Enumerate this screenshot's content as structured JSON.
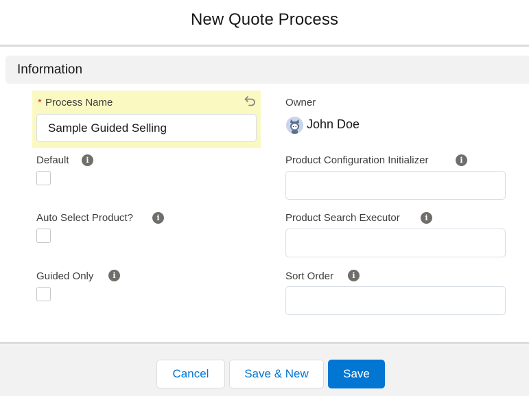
{
  "modal": {
    "title": "New Quote Process"
  },
  "section": {
    "title": "Information"
  },
  "fields": {
    "process_name": {
      "label": "Process Name",
      "required_marker": "*",
      "value": "Sample Guided Selling",
      "undo_icon": "undo-icon"
    },
    "owner": {
      "label": "Owner",
      "value": "John Doe",
      "avatar_icon": "user-avatar-icon"
    },
    "default": {
      "label": "Default",
      "info_icon": "i",
      "checked": false
    },
    "product_configuration_initializer": {
      "label": "Product Configuration Initializer",
      "info_icon": "i",
      "value": ""
    },
    "auto_select_product": {
      "label": "Auto Select Product?",
      "info_icon": "i",
      "checked": false
    },
    "product_search_executor": {
      "label": "Product Search Executor",
      "info_icon": "i",
      "value": ""
    },
    "guided_only": {
      "label": "Guided Only",
      "info_icon": "i",
      "checked": false
    },
    "sort_order": {
      "label": "Sort Order",
      "info_icon": "i",
      "value": ""
    }
  },
  "footer": {
    "cancel_label": "Cancel",
    "save_new_label": "Save & New",
    "save_label": "Save"
  },
  "colors": {
    "brand": "#0176d3",
    "highlight": "#fbf9c2",
    "required": "#c23934",
    "section_bg": "#f3f2f2"
  }
}
